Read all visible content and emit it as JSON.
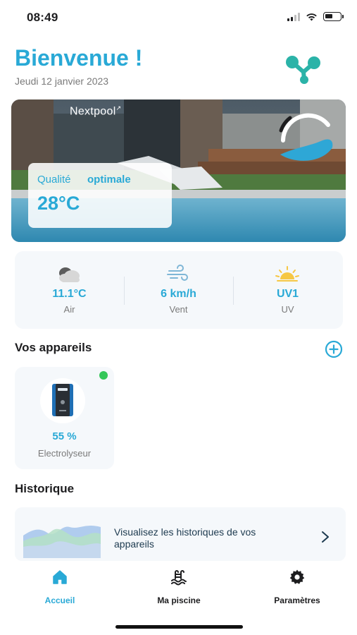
{
  "status_bar": {
    "time": "08:49",
    "battery_level": 0.55,
    "icons": [
      "signal-icon",
      "wifi-icon",
      "battery-icon"
    ]
  },
  "header": {
    "title": "Bienvenue !",
    "date": "Jeudi 12 janvier 2023",
    "logo_icon": "molecule-icon"
  },
  "hero": {
    "brand": "Nextpool",
    "brand_mark": "↗",
    "quality_label": "Qualité",
    "quality_value": "optimale",
    "temperature": "28°C"
  },
  "weather": [
    {
      "icon": "cloud-icon",
      "value": "11.1°C",
      "label": "Air"
    },
    {
      "icon": "wind-icon",
      "value": "6 km/h",
      "label": "Vent"
    },
    {
      "icon": "sun-icon",
      "value": "UV1",
      "label": "UV"
    }
  ],
  "devices": {
    "title": "Vos appareils",
    "add_icon": "plus-circle-icon",
    "items": [
      {
        "name": "Electrolyseur",
        "value": "55 %",
        "status": "online",
        "status_color": "#34c759"
      }
    ]
  },
  "history": {
    "title": "Historique",
    "card_text": "Visualisez les historiques de vos appareils",
    "chevron_icon": "chevron-right-icon"
  },
  "tabbar": {
    "items": [
      {
        "label": "Accueil",
        "icon": "home-icon",
        "active": true
      },
      {
        "label": "Ma piscine",
        "icon": "pool-icon",
        "active": false
      },
      {
        "label": "Paramètres",
        "icon": "gear-icon",
        "active": false
      }
    ]
  },
  "colors": {
    "accent": "#29a9d6",
    "muted": "#7a7a7a",
    "card_bg": "#f5f8fb",
    "online": "#34c759"
  }
}
